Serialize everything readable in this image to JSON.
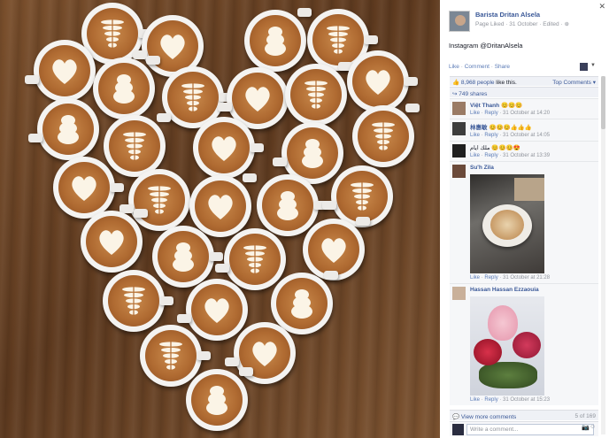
{
  "post": {
    "page_name": "Barista Dritan Alsela",
    "subtitle": "Page Liked · 31 October · Edited · ",
    "caption": "Instagram @DritanAlsela"
  },
  "actions": {
    "like": "Like",
    "comment": "Comment",
    "share": "Share",
    "sep": " · "
  },
  "stats": {
    "likes_count": "8,968 people",
    "likes_suffix": " like this.",
    "top_comments": "Top Comments ▾",
    "shares": "749 shares"
  },
  "comments": [
    {
      "name": "Việt Thanh",
      "body": "😊😊😊",
      "like": "Like",
      "reply": "Reply",
      "time": "31 October at 14:20"
    },
    {
      "name": "林惠敏",
      "body": "😊😊😊👍👍👍",
      "like": "Like",
      "reply": "Reply",
      "time": "31 October at 14:05"
    },
    {
      "name": "",
      "body": "ملك ايام 😊😊😊😍",
      "like": "Like",
      "reply": "Reply",
      "time": "31 October at 13:39"
    },
    {
      "name": "Su'h Zila",
      "body": "",
      "like": "Like",
      "reply": "Reply",
      "time": "31 October at 21:28"
    },
    {
      "name": "Hassan Hassan Ezzaouia",
      "body": "",
      "like": "Like",
      "reply": "Reply",
      "time": "31 October at 15:23"
    }
  ],
  "view_more": {
    "label": "View more comments",
    "count": "5 of 169"
  },
  "write": {
    "placeholder": "Write a comment..."
  },
  "icons": {
    "close": "close-icon",
    "camera": "camera-icon",
    "emoji": "emoji-icon",
    "globe": "globe-icon"
  },
  "colors": {
    "link": "#3b5998",
    "panel_bg": "#ffffff",
    "stats_bg": "#eff1f6",
    "wood": "#6b4426",
    "crema": "#b06b32"
  }
}
